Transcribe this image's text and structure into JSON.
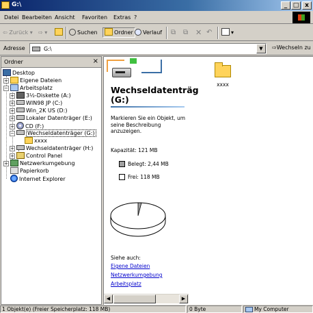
{
  "window": {
    "title": "G:\\",
    "buttons": {
      "minimize": "_",
      "maximize": "□",
      "close": "x"
    }
  },
  "menu": {
    "items": [
      "Datei",
      "Bearbeiten",
      "Ansicht",
      "Favoriten",
      "Extras",
      "?"
    ]
  },
  "toolbar": {
    "back": "Zurück",
    "search": "Suchen",
    "folders": "Ordner",
    "history": "Verlauf",
    "views_icon": "views-icon"
  },
  "address": {
    "label": "Adresse",
    "value": "G:\\",
    "go": "Wechseln zu"
  },
  "folders_pane": {
    "title": "Ordner",
    "close": "×",
    "tree": [
      {
        "label": "Desktop"
      },
      {
        "label": "Eigene Dateien"
      },
      {
        "label": "Arbeitsplatz"
      },
      {
        "label": "3½-Diskette (A:)"
      },
      {
        "label": "WIN98 JP (C:)"
      },
      {
        "label": "Win_2K US (D:)"
      },
      {
        "label": "Lokaler Datenträger (E:)"
      },
      {
        "label": "CD (F:)"
      },
      {
        "label": "Wechseldatenträger (G:)"
      },
      {
        "label": "xxxx"
      },
      {
        "label": "Wechseldatenträger (H:)"
      },
      {
        "label": "Control Panel"
      },
      {
        "label": "Netzwerkumgebung"
      },
      {
        "label": "Papierkorb"
      },
      {
        "label": "Internet Explorer"
      }
    ]
  },
  "details": {
    "title_line1": "Wechseldatenträg",
    "title_line2": "(G:)",
    "description": "Markieren Sie ein Objekt, um seine Beschreibung anzuzeigen.",
    "capacity": "Kapazität: 121 MB",
    "used": "Belegt: 2,44 MB",
    "free": "Frei: 118 MB",
    "used_fraction": 0.02,
    "used_color": "#a0a0a0",
    "free_color": "#ffffff",
    "see_also": "Siehe auch:",
    "links": [
      "Eigene Dateien",
      "Netzwerkumgebung",
      "Arbeitsplatz"
    ]
  },
  "files": [
    {
      "name": "xxxx",
      "icon": "folder-icon"
    }
  ],
  "status": {
    "objects": "1 Objekt(e) (Freier Speicherplatz: 118 MB)",
    "size": "0 Byte",
    "zone": "My Computer"
  }
}
